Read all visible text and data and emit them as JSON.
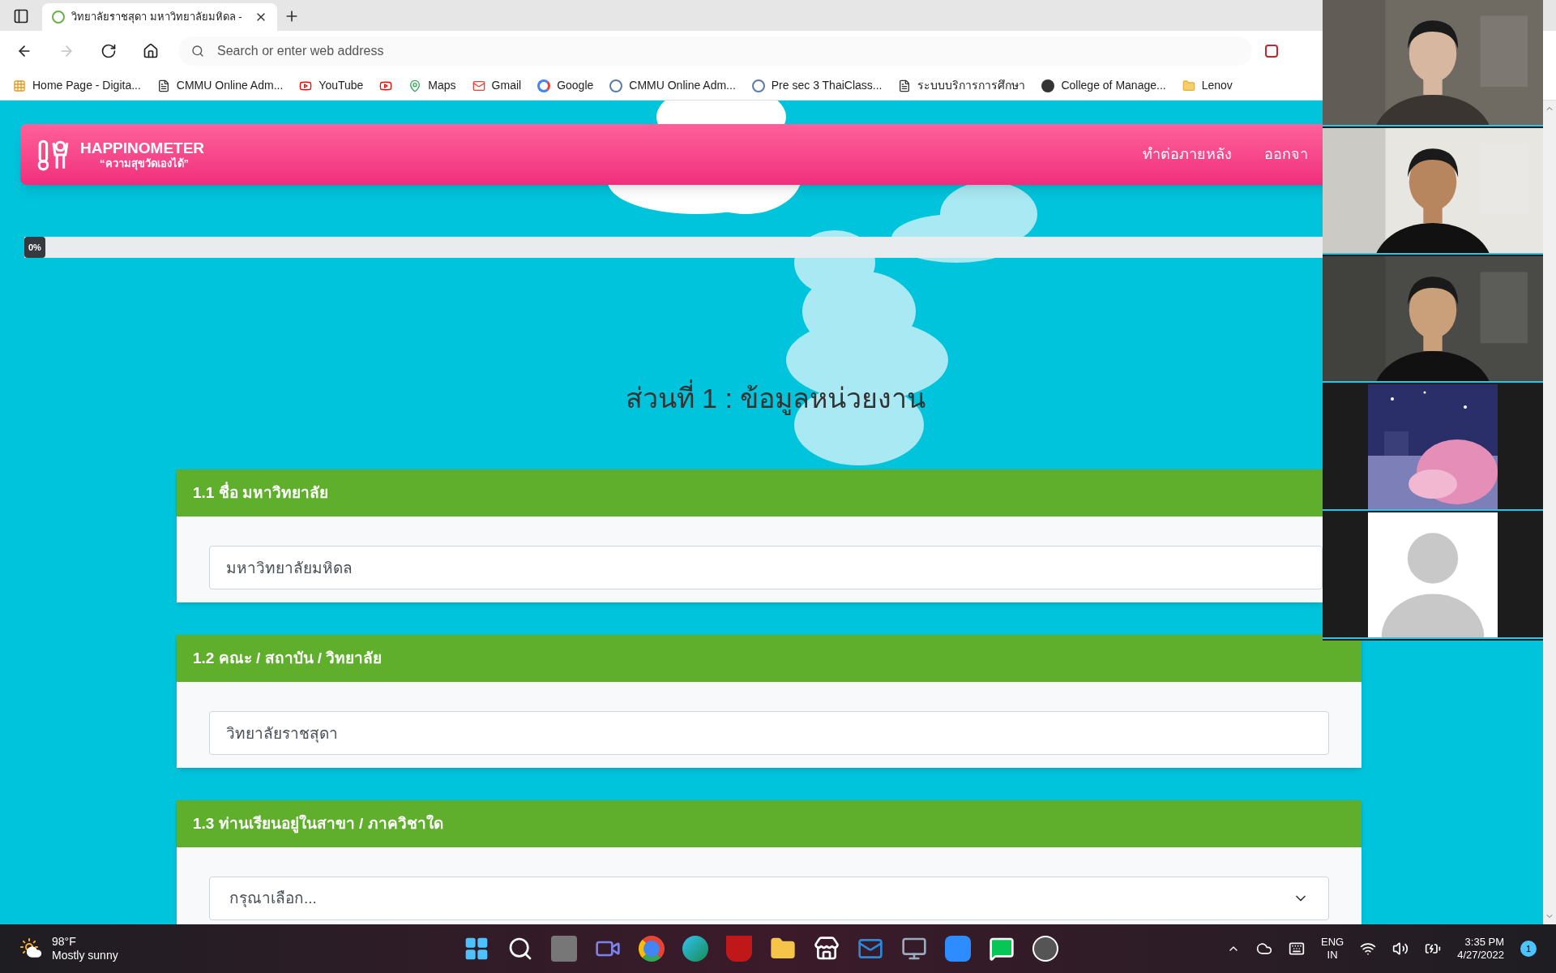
{
  "browser": {
    "tab_title": "วิทยาลัยราชสุดา มหาวิทยาลัยมหิดล -",
    "address_placeholder": "Search or enter web address",
    "bookmarks": [
      {
        "label": "Home Page - Digita...",
        "kind": "grid"
      },
      {
        "label": "CMMU Online Adm...",
        "kind": "page"
      },
      {
        "label": "YouTube",
        "kind": "youtube"
      },
      {
        "kind": "youtube"
      },
      {
        "label": "Maps",
        "kind": "maps"
      },
      {
        "label": "Gmail",
        "kind": "gmail"
      },
      {
        "label": "Google",
        "kind": "google"
      },
      {
        "label": "CMMU Online Adm...",
        "kind": "logo"
      },
      {
        "label": "Pre  sec 3 ThaiClass...",
        "kind": "logo"
      },
      {
        "label": "ระบบบริการการศึกษา",
        "kind": "page"
      },
      {
        "label": "College of Manage...",
        "kind": "circle"
      },
      {
        "label": "Lenov",
        "kind": "folder"
      }
    ]
  },
  "page": {
    "brand": "HAPPINOMETER",
    "tagline": "“ความสุขวัดเองได้”",
    "nav": [
      "ทำต่อภายหลัง",
      "ออกจา"
    ],
    "progress": {
      "label": "0%",
      "level": 0
    },
    "section_title": "ส่วนที่ 1 : ข้อมูลหน่วยงาน",
    "questions": [
      {
        "label": "1.1 ชื่อ มหาวิทยาลัย",
        "kind": "text",
        "value": "มหาวิทยาลัยมหิดล"
      },
      {
        "label": "1.2 คณะ / สถาบัน / วิทยาลัย",
        "kind": "text",
        "value": "วิทยาลัยราชสุดา"
      },
      {
        "label": "1.3 ท่านเรียนอยู่ในสาขา / ภาควิชาใด",
        "kind": "select",
        "value": "กรุณาเลือก..."
      }
    ]
  },
  "video_call": {
    "tiles": [
      {
        "kind": "picture"
      },
      {
        "kind": "picture"
      },
      {
        "kind": "picture"
      },
      {
        "kind": "picture"
      },
      {
        "kind": "avatar"
      }
    ]
  },
  "taskbar": {
    "temperature": "98°F",
    "weather": "Mostly sunny",
    "language": "ENG",
    "region": "IN",
    "time": "3:35 PM",
    "date": "4/27/2022",
    "notifications": "1"
  }
}
